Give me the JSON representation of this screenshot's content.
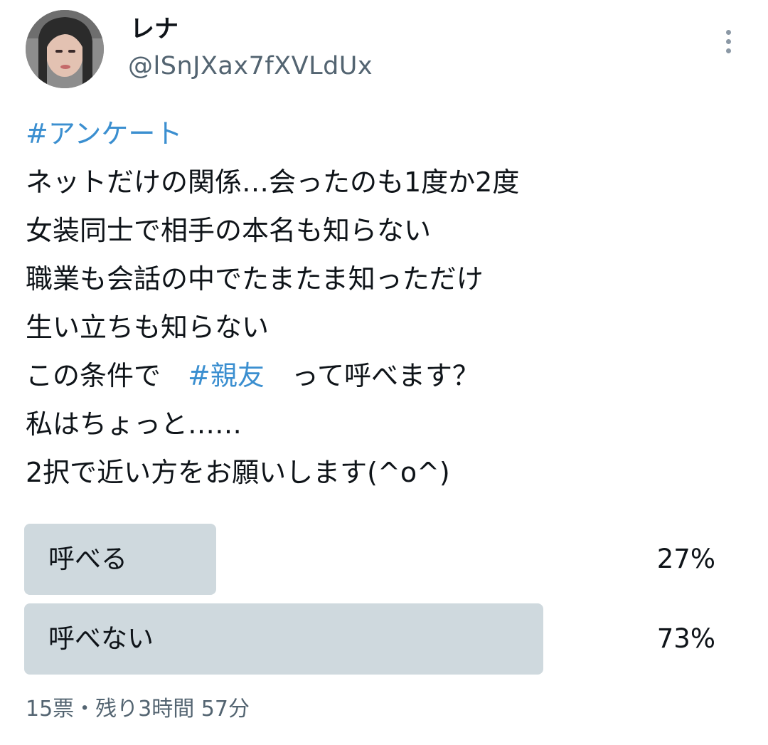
{
  "user": {
    "display_name": "レナ",
    "handle": "@lSnJXax7fXVLdUx"
  },
  "icons": {
    "more": "more-vertical-icon",
    "avatar": "profile-photo"
  },
  "tweet": {
    "lines": [
      [
        {
          "text": "#アンケート",
          "hashtag": true
        }
      ],
      [
        {
          "text": "ネットだけの関係…会ったのも1度か2度",
          "hashtag": false
        }
      ],
      [
        {
          "text": "女装同士で相手の本名も知らない",
          "hashtag": false
        }
      ],
      [
        {
          "text": "職業も会話の中でたまたま知っただけ",
          "hashtag": false
        }
      ],
      [
        {
          "text": "生い立ちも知らない",
          "hashtag": false
        }
      ],
      [
        {
          "text": "この条件で　",
          "hashtag": false
        },
        {
          "text": "#親友",
          "hashtag": true
        },
        {
          "text": "　って呼べます？",
          "hashtag": false
        }
      ],
      [
        {
          "text": "私はちょっと……",
          "hashtag": false
        }
      ],
      [
        {
          "text": "2択で近い方をお願いします(^o^)",
          "hashtag": false
        }
      ]
    ]
  },
  "poll": {
    "options": [
      {
        "label": "呼べる",
        "percent_text": "27%",
        "percent": 27
      },
      {
        "label": "呼べない",
        "percent_text": "73%",
        "percent": 73
      }
    ],
    "meta": "15票・残り3時間 57分"
  },
  "colors": {
    "hashtag": "#3b8fd0",
    "poll_bar": "#cfd9de",
    "secondary_text": "#536471"
  }
}
